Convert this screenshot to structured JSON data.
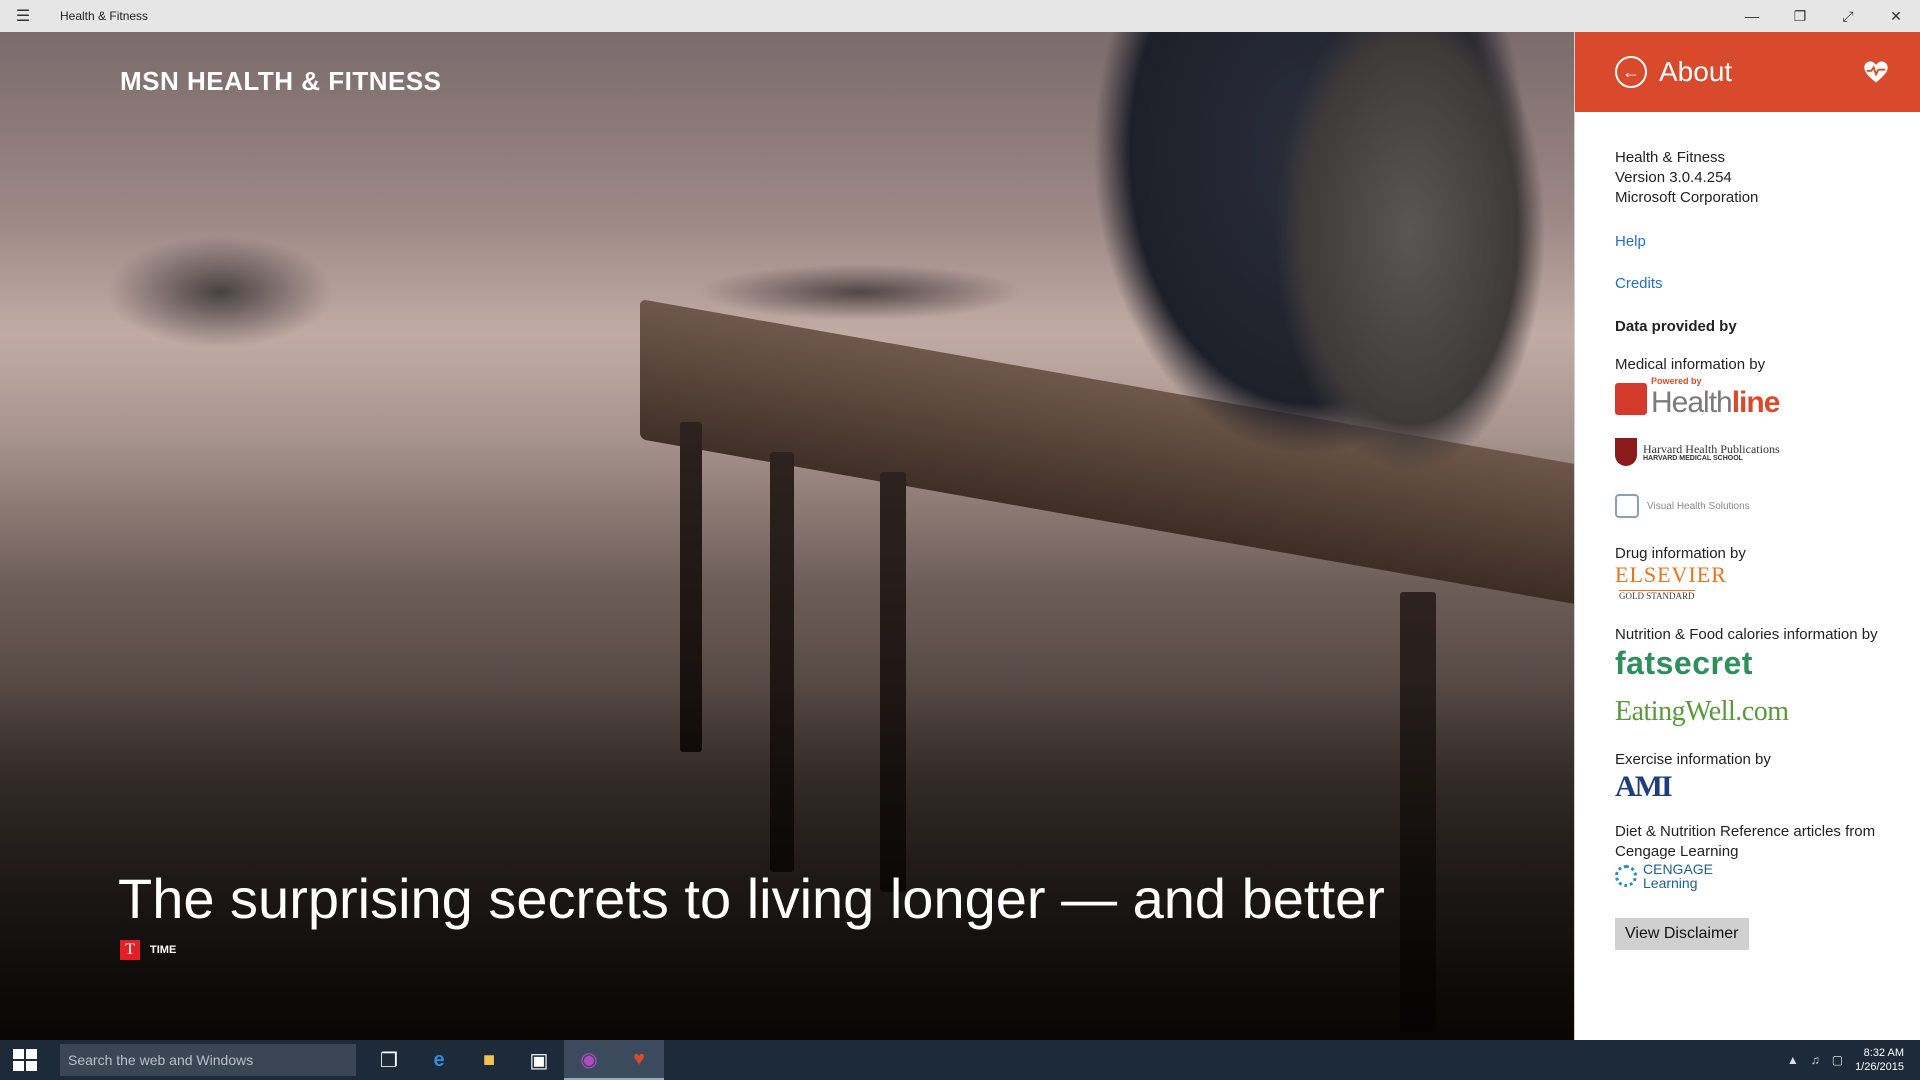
{
  "window": {
    "title": "Health & Fitness"
  },
  "hero": {
    "brand": "MSN HEALTH & FITNESS",
    "headline": "The surprising secrets to living longer — and better",
    "source_letter": "T",
    "source": "TIME"
  },
  "about": {
    "title": "About",
    "app_name": "Health & Fitness",
    "version": "Version 3.0.4.254",
    "company": "Microsoft Corporation",
    "help_label": "Help",
    "credits_label": "Credits",
    "data_provided_by": "Data provided by",
    "medical_label": "Medical information by",
    "healthline": {
      "pre": "Powered by",
      "main": "Health",
      "suffix": "line"
    },
    "harvard": {
      "line1": "Harvard Health Publications",
      "line2": "HARVARD MEDICAL SCHOOL"
    },
    "visual_health": "Visual Health Solutions",
    "drug_label": "Drug information by",
    "elsevier": {
      "line1": "ELSEVIER",
      "line2": "GOLD STANDARD"
    },
    "nutrition_label": "Nutrition & Food calories information by",
    "fatsecret": "fatsecret",
    "eatingwell": "EatingWell.com",
    "exercise_label": "Exercise information by",
    "ami": "AMI",
    "diet_label": "Diet & Nutrition Reference articles from Cengage Learning",
    "cengage": {
      "line1": "CENGAGE",
      "line2": "Learning"
    },
    "disclaimer_button": "View Disclaimer"
  },
  "taskbar": {
    "search_placeholder": "Search the web and Windows",
    "time": "8:32 AM",
    "date": "1/26/2015"
  },
  "colors": {
    "accent": "#d84a2b",
    "link": "#1f6fc5",
    "taskbar": "#1c2a3a"
  }
}
